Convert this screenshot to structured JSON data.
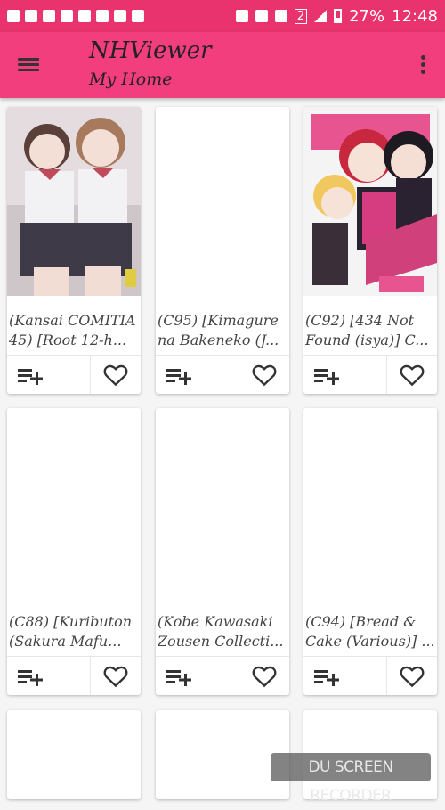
{
  "status_bar": {
    "time": "12:48",
    "battery": "27%",
    "sim_slot": "2"
  },
  "toolbar": {
    "title": "NHViewer",
    "subtitle": "My Home"
  },
  "colors": {
    "accent": "#f23e7d",
    "status_bar": "#e8336e"
  },
  "cards": [
    {
      "line1": "(Kansai COMITIA",
      "line2": "45) [Root 12-h...",
      "has_cover": true
    },
    {
      "line1": "(C95) [Kimagure",
      "line2": "na Bakeneko (J...",
      "has_cover": false
    },
    {
      "line1": "(C92) [434 Not",
      "line2": "Found (isya)] C...",
      "has_cover": true
    },
    {
      "line1": "(C88) [Kuributon",
      "line2": "(Sakura Mafu...",
      "has_cover": false
    },
    {
      "line1": "(Kobe Kawasaki",
      "line2": "Zousen Collecti...",
      "has_cover": false
    },
    {
      "line1": "(C94) [Bread &",
      "line2": "Cake (Various)] ...",
      "has_cover": false
    }
  ],
  "watermark": "DU SCREEN RECORDER"
}
